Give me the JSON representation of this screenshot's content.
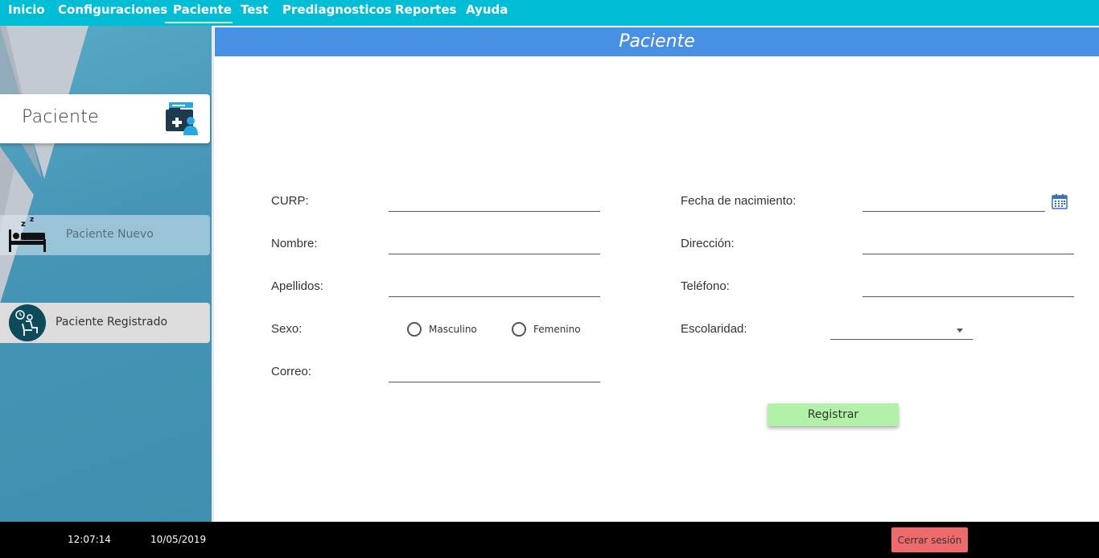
{
  "menu": {
    "items": [
      {
        "label": "Inicio"
      },
      {
        "label": "Configuraciones"
      },
      {
        "label": "Paciente",
        "active": true
      },
      {
        "label": "Test"
      },
      {
        "label": "Prediagnosticos"
      },
      {
        "label": "Reportes"
      },
      {
        "label": "Ayuda"
      }
    ]
  },
  "sidebar": {
    "card_title": "Paciente",
    "card_icon": "patient-folder-icon",
    "items": [
      {
        "label": "Paciente Nuevo",
        "icon": "sleeping-bed-icon"
      },
      {
        "label": "Paciente Registrado",
        "icon": "patient-waiting-icon"
      }
    ]
  },
  "header": {
    "title": "Paciente"
  },
  "form": {
    "curp_label": "CURP:",
    "nombre_label": "Nombre:",
    "apellidos_label": "Apellidos:",
    "sexo_label": "Sexo:",
    "sexo_options": [
      "Masculino",
      "Femenino"
    ],
    "correo_label": "Correo:",
    "fecha_label": "Fecha de nacimiento:",
    "direccion_label": "Dirección:",
    "telefono_label": "Teléfono:",
    "escolaridad_label": "Escolaridad:",
    "escolaridad_value": "",
    "values": {
      "curp": "",
      "nombre": "",
      "apellidos": "",
      "correo": "",
      "fecha": "",
      "direccion": "",
      "telefono": ""
    },
    "submit_label": "Registrar"
  },
  "footer": {
    "time": "12:07:14",
    "date": "10/05/2019",
    "logout_label": "Cerrar sesión"
  },
  "colors": {
    "menubar": "#00bcd4",
    "header": "#4a90e2",
    "submit": "#b2f2a8",
    "logout": "#ef6b6b"
  }
}
